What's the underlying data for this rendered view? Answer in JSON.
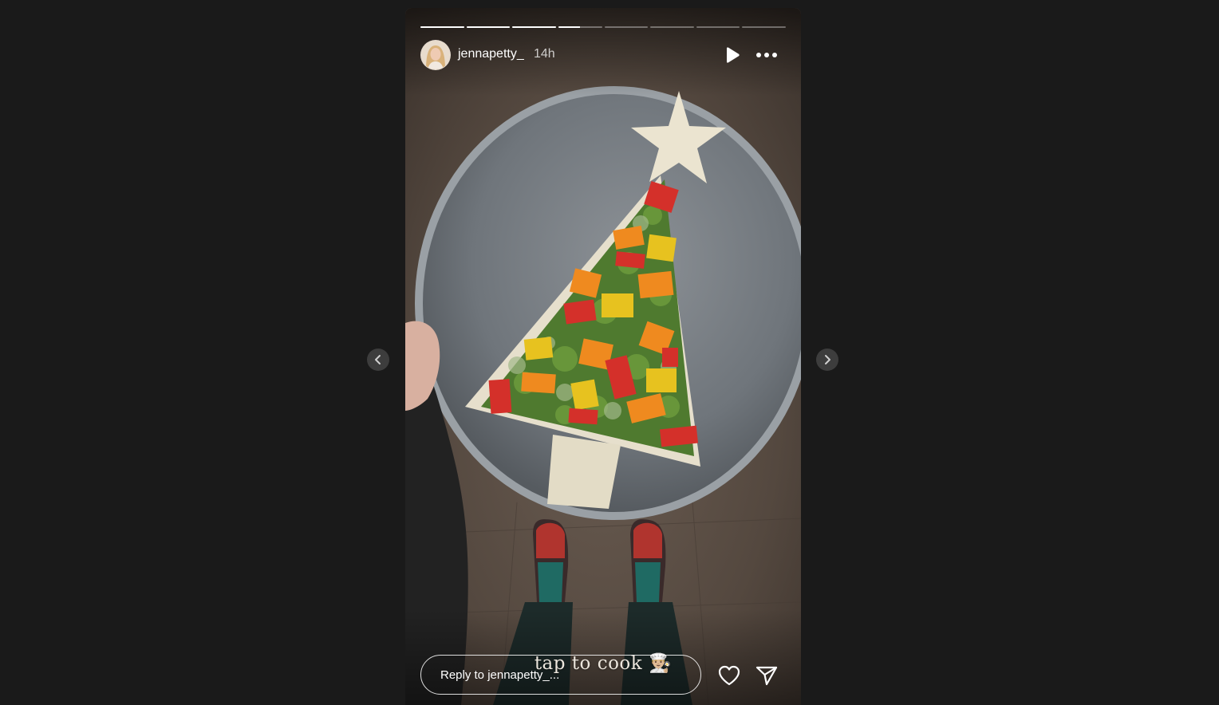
{
  "story": {
    "username": "jennapetty_",
    "time_ago": "14h",
    "caption": "tap to cook 👨🏼‍🍳",
    "progress": {
      "segments": 8,
      "current_index": 3,
      "current_fraction": 0.5
    },
    "reply": {
      "placeholder": "Reply to jennapetty_..."
    }
  },
  "icons": {
    "play": "play-icon",
    "more": "more-horizontal-icon",
    "heart": "heart-icon",
    "send": "send-icon",
    "prev": "chevron-left-icon",
    "next": "chevron-right-icon"
  },
  "colors": {
    "background": "#1a1a1a",
    "text": "#ffffff",
    "nav_button": "#3d3d3d"
  }
}
